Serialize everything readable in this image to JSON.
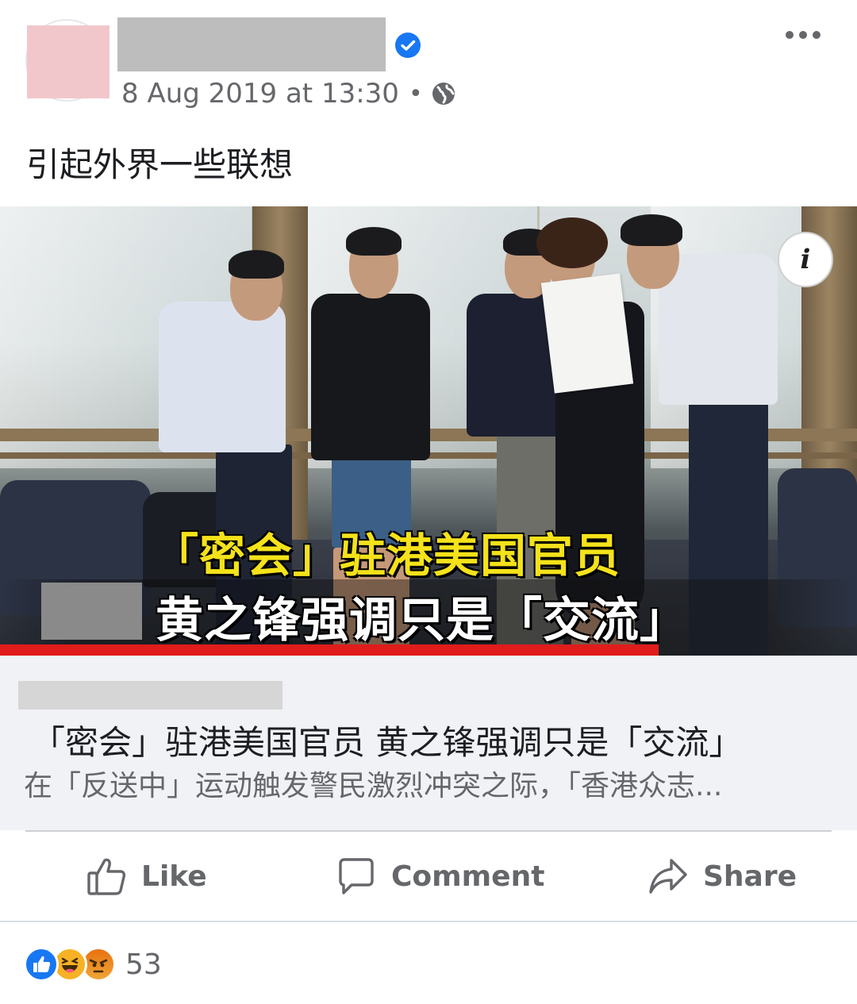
{
  "post": {
    "timestamp": "8 Aug 2019 at 13:30",
    "separator": "•",
    "privacy_icon": "globe-icon",
    "text": "引起外界一些联想"
  },
  "image": {
    "caption_line1": "「密会」驻港美国官员",
    "caption_line2": "黄之锋强调只是「交流」",
    "info_label": "i"
  },
  "link_preview": {
    "title": "「密会」驻港美国官员 黄之锋强调只是「交流」",
    "description": "在「反送中」运动触发警民激烈冲突之际，「香港众志..."
  },
  "actions": {
    "like_label": "Like",
    "comment_label": "Comment",
    "share_label": "Share"
  },
  "reactions": {
    "types": [
      "like",
      "haha",
      "angry"
    ],
    "count": "53"
  },
  "colors": {
    "accent": "#1877f2",
    "muted_text": "#65676b",
    "caption_yellow": "#f4e21a",
    "caption_red": "#e01c1c"
  }
}
